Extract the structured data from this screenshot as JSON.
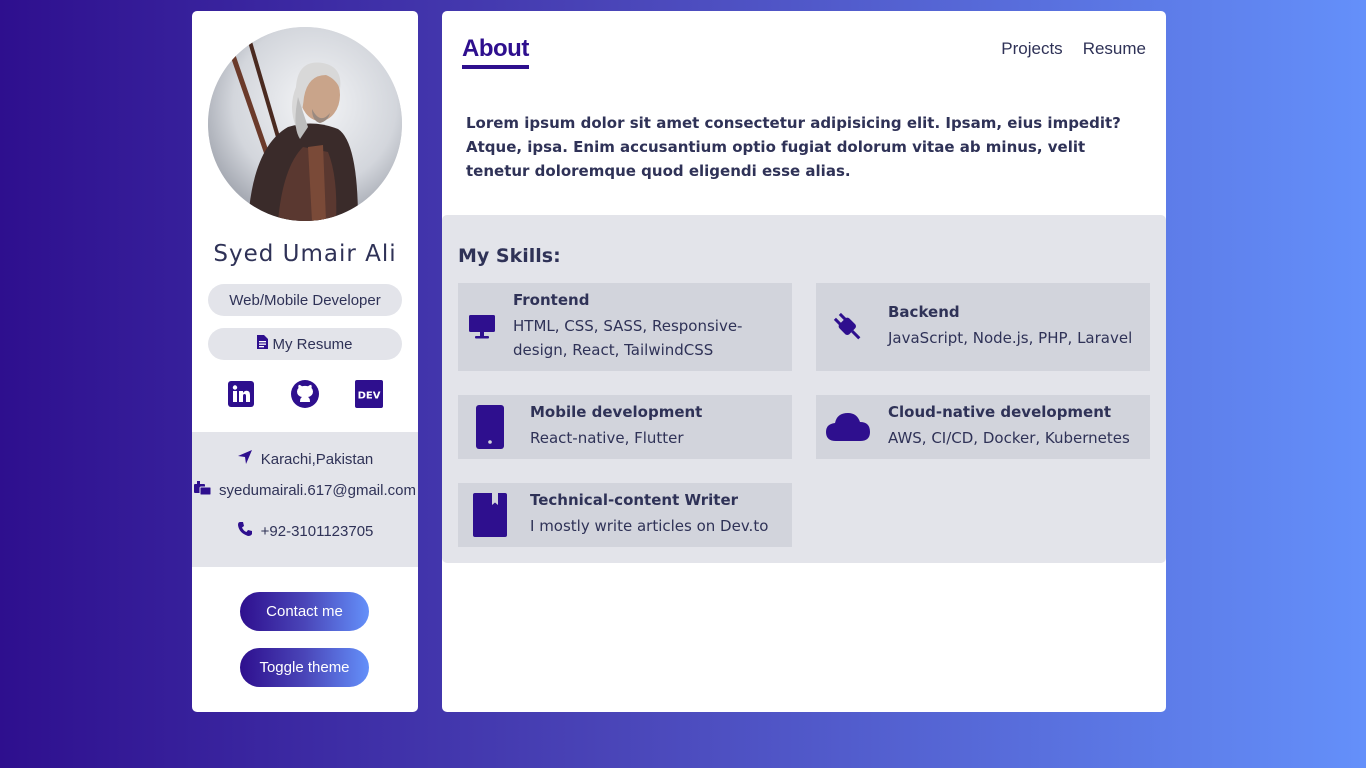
{
  "profile": {
    "name": "Syed Umair Ali",
    "role": "Web/Mobile Developer",
    "resume_label": "My Resume",
    "location": "Karachi,Pakistan",
    "email": "syedumairali.617@gmail.com",
    "phone": "+92-3101123705",
    "socials": [
      {
        "icon": "linkedin-icon"
      },
      {
        "icon": "github-icon"
      },
      {
        "icon": "dev-icon",
        "text": "DEV"
      }
    ]
  },
  "buttons": {
    "contact": "Contact me",
    "theme": "Toggle theme"
  },
  "nav": {
    "active": "About",
    "items": [
      "Projects",
      "Resume"
    ]
  },
  "about": {
    "text": "Lorem ipsum dolor sit amet consectetur adipisicing elit. Ipsam, eius impedit? Atque, ipsa. Enim accusantium optio fugiat dolorum vitae ab minus, velit tenetur doloremque quod eligendi esse alias."
  },
  "skills": {
    "heading": "My Skills:",
    "items": [
      {
        "title": "Frontend",
        "desc": "HTML, CSS, SASS, Responsive-design, React, TailwindCSS",
        "icon": "monitor-icon"
      },
      {
        "title": "Backend",
        "desc": "JavaScript, Node.js, PHP, Laravel",
        "icon": "plug-icon"
      },
      {
        "title": "Mobile development",
        "desc": "React-native, Flutter",
        "icon": "mobile-icon"
      },
      {
        "title": "Cloud-native development",
        "desc": "AWS, CI/CD, Docker, Kubernetes",
        "icon": "cloud-icon"
      },
      {
        "title": "Technical-content Writer",
        "desc": "I mostly write articles on Dev.to",
        "icon": "book-icon"
      }
    ]
  },
  "colors": {
    "accent": "#2e0f8e",
    "gradient_end": "#6490fa",
    "panel": "#e3e4ea",
    "card": "#d2d4dc",
    "text": "#2f3257"
  }
}
